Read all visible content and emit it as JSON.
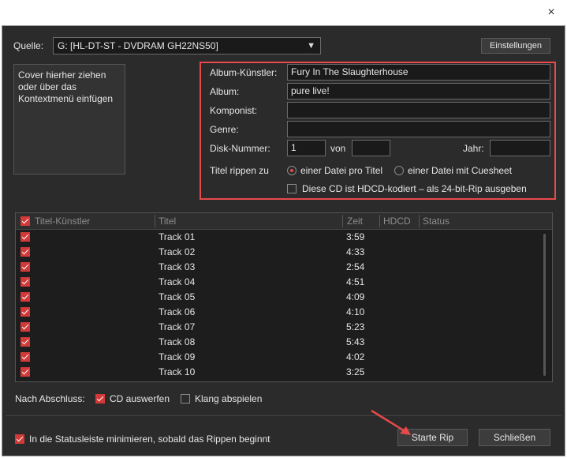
{
  "window": {
    "close_glyph": "×"
  },
  "source": {
    "label": "Quelle:",
    "value": "G: [HL-DT-ST - DVDRAM GH22NS50]",
    "settings_button": "Einstellungen"
  },
  "cover": {
    "placeholder": "Cover hierher ziehen\noder über das\nKontextmenü einfügen"
  },
  "meta": {
    "album_artist": {
      "label": "Album-Künstler:",
      "value": "Fury In The Slaughterhouse"
    },
    "album": {
      "label": "Album:",
      "value": "pure live!"
    },
    "composer": {
      "label": "Komponist:",
      "value": ""
    },
    "genre": {
      "label": "Genre:",
      "value": ""
    },
    "disc": {
      "label": "Disk-Nummer:",
      "value": "1",
      "of_label": "von",
      "of_value": ""
    },
    "year": {
      "label": "Jahr:",
      "value": ""
    },
    "rip_mode": {
      "label": "Titel rippen zu",
      "option1": "einer Datei pro Titel",
      "option2": "einer Datei mit Cuesheet",
      "selected": "option1"
    },
    "hdcd": {
      "label": "Diese CD ist HDCD-kodiert – als 24-bit-Rip ausgeben",
      "checked": false
    }
  },
  "table": {
    "headers": {
      "artist": "Titel-Künstler",
      "title": "Titel",
      "time": "Zeit",
      "hdcd": "HDCD",
      "status": "Status"
    },
    "rows": [
      {
        "checked": true,
        "artist": "",
        "title": "Track 01",
        "time": "3:59"
      },
      {
        "checked": true,
        "artist": "",
        "title": "Track 02",
        "time": "4:33"
      },
      {
        "checked": true,
        "artist": "",
        "title": "Track 03",
        "time": "2:54"
      },
      {
        "checked": true,
        "artist": "",
        "title": "Track 04",
        "time": "4:51"
      },
      {
        "checked": true,
        "artist": "",
        "title": "Track 05",
        "time": "4:09"
      },
      {
        "checked": true,
        "artist": "",
        "title": "Track 06",
        "time": "4:10"
      },
      {
        "checked": true,
        "artist": "",
        "title": "Track 07",
        "time": "5:23"
      },
      {
        "checked": true,
        "artist": "",
        "title": "Track 08",
        "time": "5:43"
      },
      {
        "checked": true,
        "artist": "",
        "title": "Track 09",
        "time": "4:02"
      },
      {
        "checked": true,
        "artist": "",
        "title": "Track 10",
        "time": "3:25"
      }
    ]
  },
  "after": {
    "label": "Nach Abschluss:",
    "eject": {
      "label": "CD auswerfen",
      "checked": true
    },
    "sound": {
      "label": "Klang abspielen",
      "checked": false
    }
  },
  "footer": {
    "minimize": {
      "label": "In die Statusleiste minimieren, sobald das Rippen beginnt",
      "checked": true
    },
    "start_button": "Starte Rip",
    "close_button": "Schließen"
  },
  "colors": {
    "accent": "#e8494b",
    "background": "#2b2b2b",
    "text": "#e6e6e6"
  }
}
